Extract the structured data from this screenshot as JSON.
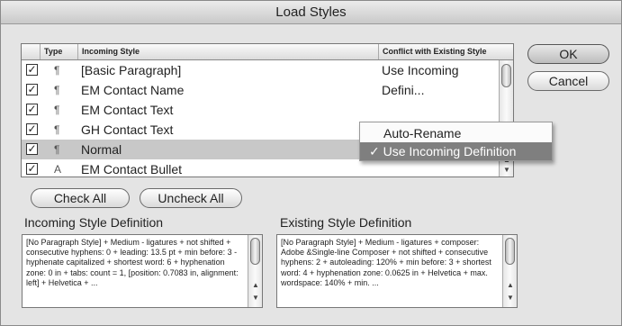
{
  "window": {
    "title": "Load Styles"
  },
  "table": {
    "headers": {
      "type": "Type",
      "incoming": "Incoming Style",
      "conflict": "Conflict with Existing Style"
    },
    "rows": [
      {
        "checked": true,
        "type_icon": "¶",
        "name": "[Basic Paragraph]",
        "conflict": "Use Incoming Defini..."
      },
      {
        "checked": true,
        "type_icon": "¶",
        "name": "EM Contact Name",
        "conflict": ""
      },
      {
        "checked": true,
        "type_icon": "¶",
        "name": "EM Contact Text",
        "conflict": ""
      },
      {
        "checked": true,
        "type_icon": "¶",
        "name": "GH Contact Text",
        "conflict": ""
      },
      {
        "checked": true,
        "type_icon": "¶",
        "name": "Normal",
        "conflict": ""
      },
      {
        "checked": true,
        "type_icon": "A",
        "name": "EM Contact Bullet",
        "conflict": ""
      }
    ],
    "checkmark": "✓"
  },
  "popup": {
    "items": [
      "Auto-Rename",
      "✓ Use Incoming Definition"
    ]
  },
  "buttons": {
    "ok": "OK",
    "cancel": "Cancel",
    "check_all": "Check All",
    "uncheck_all": "Uncheck All"
  },
  "incoming_def": {
    "label": "Incoming Style Definition",
    "text": "[No Paragraph Style] + Medium - ligatures + not shifted + consecutive hyphens: 0 + leading: 13.5 pt + min before: 3 - hyphenate capitalized + shortest word: 6 + hyphenation zone: 0 in + tabs: count = 1, [position: 0.7083 in, alignment: left] + Helvetica + ..."
  },
  "existing_def": {
    "label": "Existing Style Definition",
    "text": "[No Paragraph Style] + Medium - ligatures + composer: Adobe &Single-line Composer + not shifted + consecutive hyphens: 2 + autoleading: 120% + min before: 3 + shortest word: 4 + hyphenation zone: 0.0625 in + Helvetica + max. wordspace: 140% + min. ..."
  },
  "colors": {
    "dialog_bg": "#e4e4e4",
    "selected_row": "#c8c8c8",
    "menu_highlight": "#7f7f7f"
  }
}
